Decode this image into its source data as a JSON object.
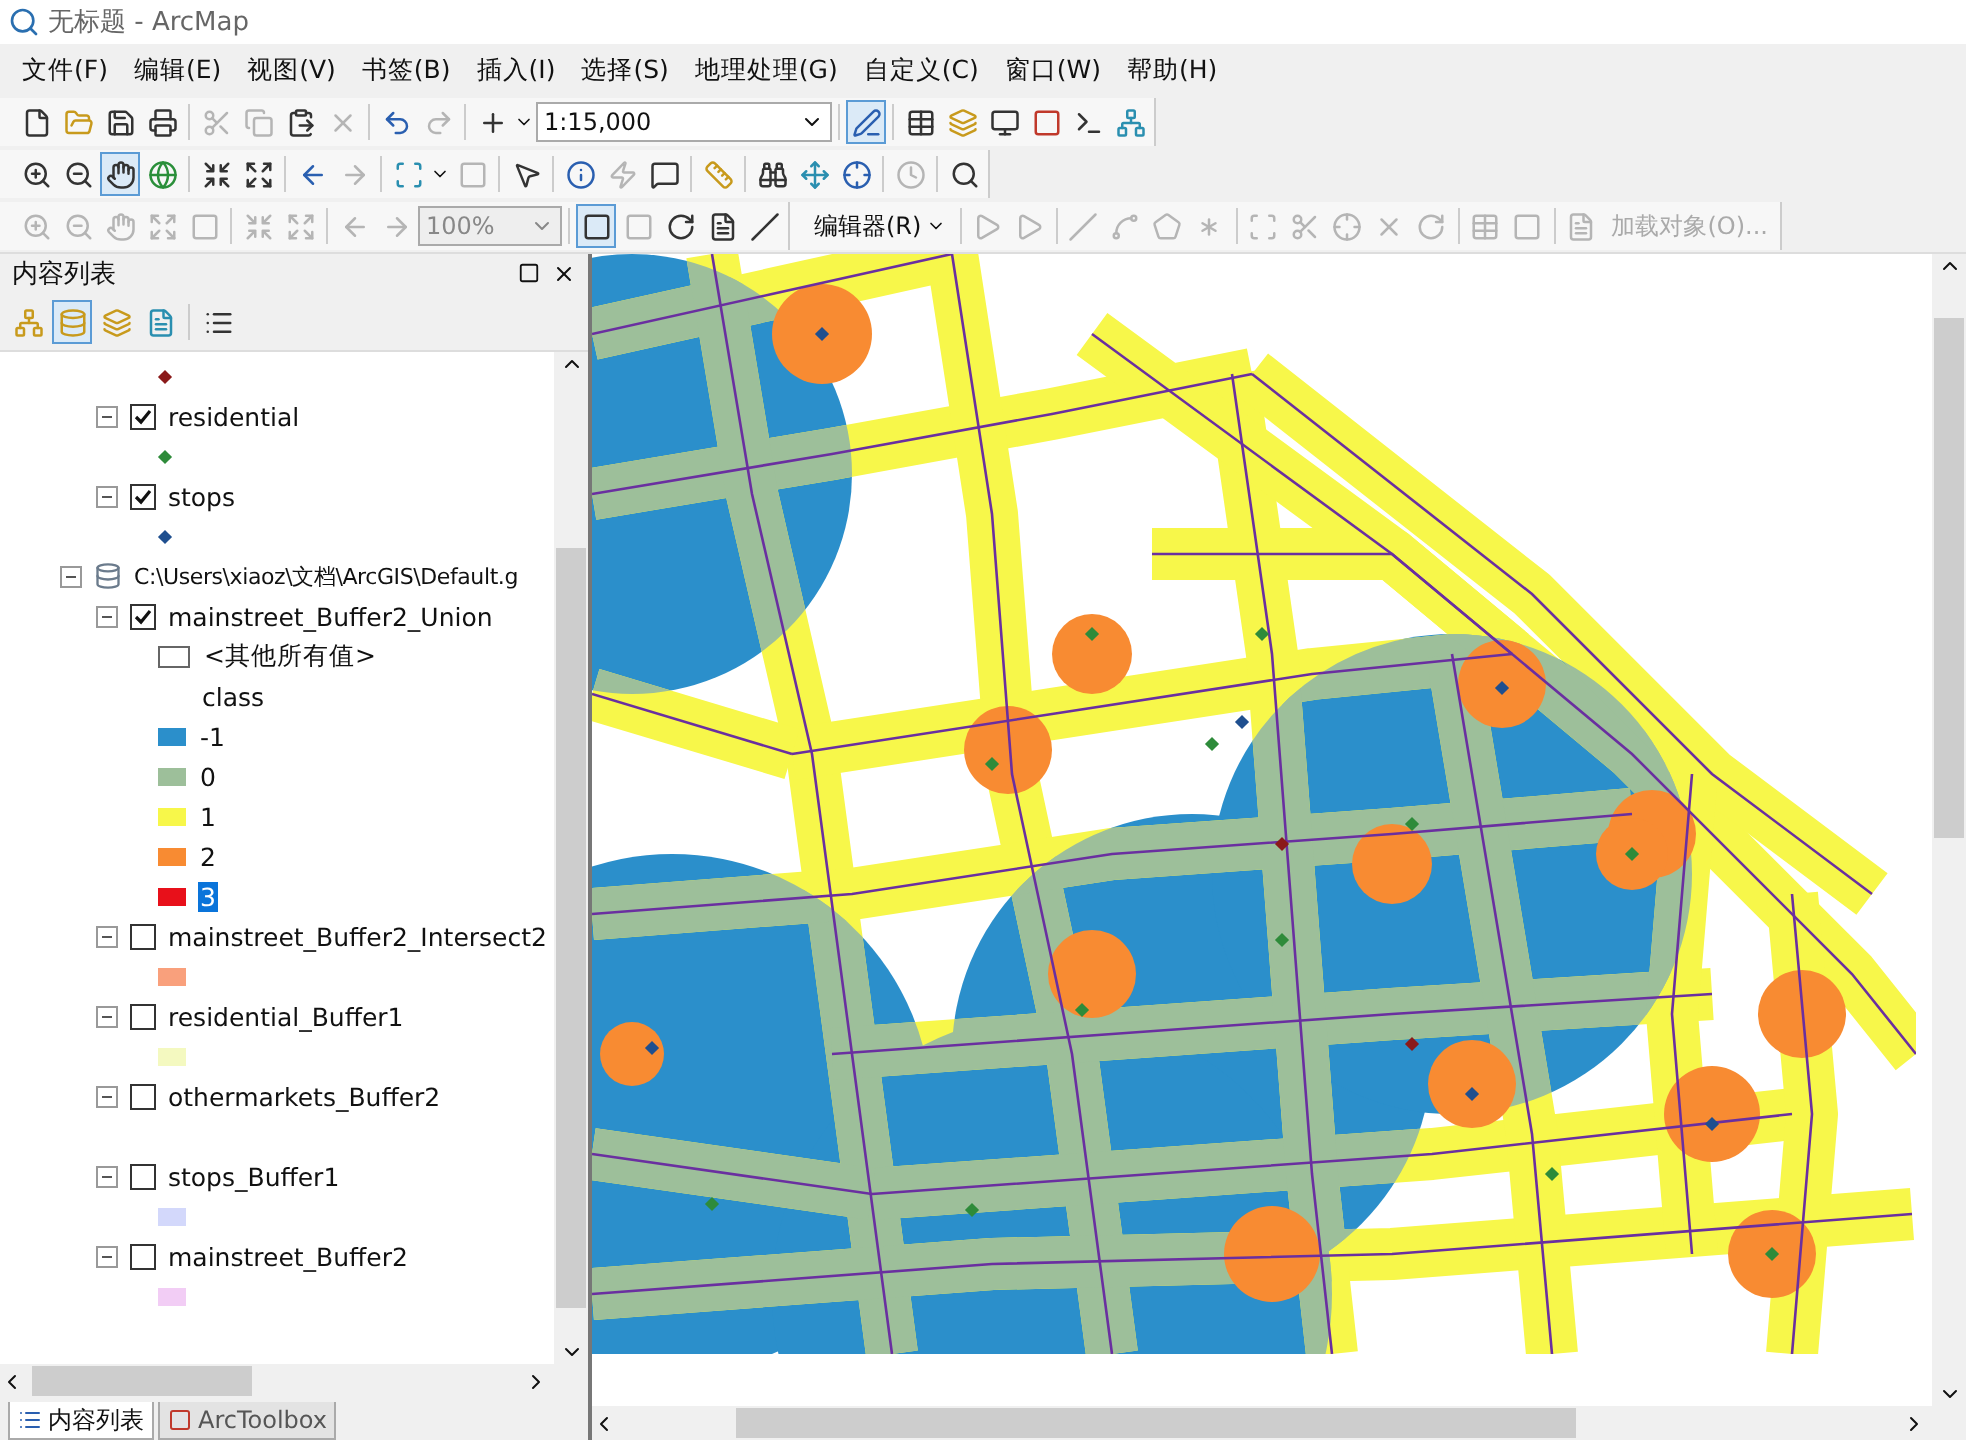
{
  "window": {
    "title": "无标题 - ArcMap"
  },
  "menu": [
    "文件(F)",
    "编辑(E)",
    "视图(V)",
    "书签(B)",
    "插入(I)",
    "选择(S)",
    "地理处理(G)",
    "自定义(C)",
    "窗口(W)",
    "帮助(H)"
  ],
  "toolbars": {
    "scale": "1:15,000",
    "zoom_percent": "100%",
    "editor_menu": "编辑器(R)",
    "load_objects": "加载对象(O)..."
  },
  "toc": {
    "title": "内容列表",
    "tree": [
      {
        "kind": "symbol",
        "color": "#8b1a1a"
      },
      {
        "kind": "layer",
        "label": "residential",
        "checked": true,
        "symbols": [
          {
            "color": "#2e8b3a"
          }
        ]
      },
      {
        "kind": "layer",
        "label": "stops",
        "checked": true,
        "symbols": [
          {
            "color": "#1f4f8f"
          }
        ]
      },
      {
        "kind": "frame",
        "label": "C:\\Users\\xiaoz\\文档\\ArcGIS\\Default.g",
        "children": [
          {
            "kind": "layer",
            "label": "mainstreet_Buffer2_Union",
            "checked": true,
            "legend": [
              {
                "kind": "swatch",
                "label": "<其他所有值>",
                "color": "#ffffff",
                "selected": false
              },
              {
                "kind": "heading",
                "label": "class"
              },
              {
                "kind": "swatch",
                "label": "-1",
                "color": "#2b8fcb",
                "selected": false
              },
              {
                "kind": "swatch",
                "label": "0",
                "color": "#9dbf9a",
                "selected": false
              },
              {
                "kind": "swatch",
                "label": "1",
                "color": "#f7f74a",
                "selected": false
              },
              {
                "kind": "swatch",
                "label": "2",
                "color": "#f88b32",
                "selected": false
              },
              {
                "kind": "swatch",
                "label": "3",
                "color": "#e8101a",
                "selected": true
              }
            ]
          },
          {
            "kind": "layer",
            "label": "mainstreet_Buffer2_Intersect2",
            "checked": false,
            "legend": [
              {
                "kind": "swatch",
                "color": "#f9a07c"
              }
            ]
          },
          {
            "kind": "layer",
            "label": "residential_Buffer1",
            "checked": false,
            "legend": [
              {
                "kind": "swatch",
                "color": "#f4f9c0"
              }
            ]
          },
          {
            "kind": "layer",
            "label": "othermarkets_Buffer2",
            "checked": false,
            "legend": [
              {
                "kind": "blank"
              }
            ]
          },
          {
            "kind": "layer",
            "label": "stops_Buffer1",
            "checked": false,
            "legend": [
              {
                "kind": "swatch",
                "color": "#d3d8fb"
              }
            ]
          },
          {
            "kind": "layer",
            "label": "mainstreet_Buffer2",
            "checked": false,
            "legend": [
              {
                "kind": "swatch",
                "color": "#f2cdf5"
              }
            ]
          }
        ]
      }
    ],
    "tabs": [
      {
        "label": "内容列表",
        "selected": true
      },
      {
        "label": "ArcToolbox",
        "selected": false
      }
    ]
  }
}
